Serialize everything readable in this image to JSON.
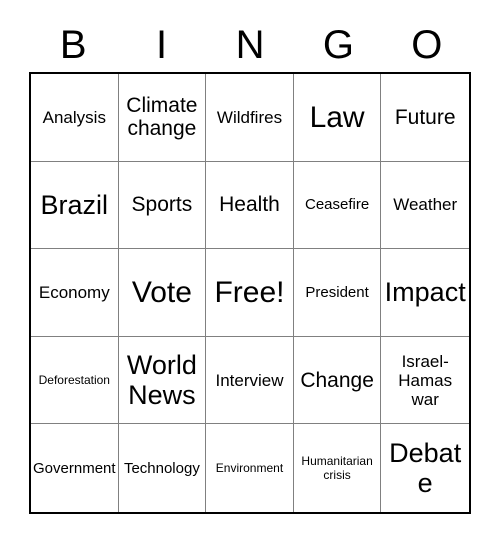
{
  "header": {
    "letters": [
      "B",
      "I",
      "N",
      "G",
      "O"
    ]
  },
  "grid": {
    "rows": [
      [
        {
          "label": "Analysis",
          "size": "sm"
        },
        {
          "label": "Climate change",
          "size": "md"
        },
        {
          "label": "Wildfires",
          "size": "sm"
        },
        {
          "label": "Law",
          "size": "xl"
        },
        {
          "label": "Future",
          "size": "md"
        }
      ],
      [
        {
          "label": "Brazil",
          "size": "lg"
        },
        {
          "label": "Sports",
          "size": "md"
        },
        {
          "label": "Health",
          "size": "md"
        },
        {
          "label": "Ceasefire",
          "size": "xs"
        },
        {
          "label": "Weather",
          "size": "sm"
        }
      ],
      [
        {
          "label": "Economy",
          "size": "sm"
        },
        {
          "label": "Vote",
          "size": "xl"
        },
        {
          "label": "Free!",
          "size": "xl"
        },
        {
          "label": "President",
          "size": "xs"
        },
        {
          "label": "Impact",
          "size": "lg"
        }
      ],
      [
        {
          "label": "Deforestation",
          "size": "xxs"
        },
        {
          "label": "World News",
          "size": "lg"
        },
        {
          "label": "Interview",
          "size": "sm"
        },
        {
          "label": "Change",
          "size": "md"
        },
        {
          "label": "Israel-Hamas war",
          "size": "sm"
        }
      ],
      [
        {
          "label": "Government",
          "size": "xs"
        },
        {
          "label": "Technology",
          "size": "xs"
        },
        {
          "label": "Environment",
          "size": "xxs"
        },
        {
          "label": "Humanitarian crisis",
          "size": "xxs"
        },
        {
          "label": "Debate",
          "size": "lg"
        }
      ]
    ]
  },
  "colors": {
    "background": "#ffffff",
    "text": "#000000",
    "outer_border": "#000000",
    "inner_border": "#808080"
  }
}
